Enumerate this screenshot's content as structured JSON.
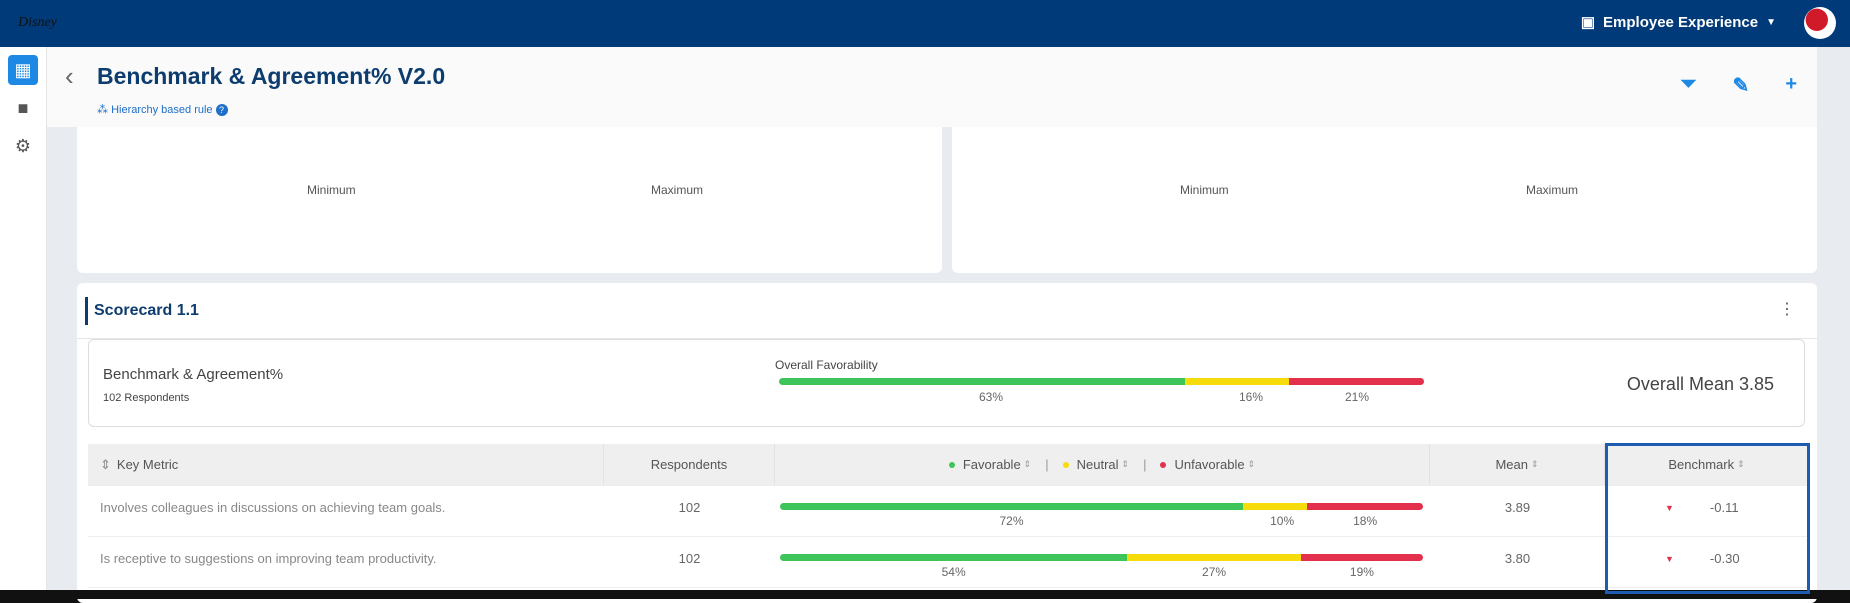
{
  "topbar": {
    "logo": "Disney",
    "app_name": "Employee Experience",
    "colors": {
      "bar": "#003a78"
    }
  },
  "header": {
    "title": "Benchmark & Agreement% V2.0",
    "rule": "Hierarchy based rule"
  },
  "cards": [
    {
      "min": "Minimum",
      "max": "Maximum"
    },
    {
      "min": "Minimum",
      "max": "Maximum"
    }
  ],
  "scorecard": {
    "title": "Scorecard 1.1",
    "summary": {
      "name": "Benchmark & Agreement%",
      "respondents": "102 Respondents",
      "fav_label": "Overall Favorability",
      "favorable": 63,
      "neutral": 16,
      "unfavorable": 21,
      "fav_text": "63%",
      "neu_text": "16%",
      "unf_text": "21%",
      "overall_mean": "Overall Mean 3.85"
    },
    "columns": {
      "key_metric": "Key Metric",
      "respondents": "Respondents",
      "favorable": "Favorable",
      "neutral": "Neutral",
      "unfavorable": "Unfavorable",
      "mean": "Mean",
      "benchmark": "Benchmark"
    },
    "rows": [
      {
        "metric": "Involves colleagues in discussions on achieving team goals.",
        "respondents": "102",
        "favorable": 72,
        "neutral": 10,
        "unfavorable": 18,
        "fav_text": "72%",
        "neu_text": "10%",
        "unf_text": "18%",
        "mean": "3.89",
        "benchmark": "-0.11"
      },
      {
        "metric": "Is receptive to suggestions on improving team productivity.",
        "respondents": "102",
        "favorable": 54,
        "neutral": 27,
        "unfavorable": 19,
        "fav_text": "54%",
        "neu_text": "27%",
        "unf_text": "19%",
        "mean": "3.80",
        "benchmark": "-0.30"
      }
    ]
  },
  "colors": {
    "favorable": "#3dc55a",
    "neutral": "#f7dc0b",
    "unfavorable": "#e2304d",
    "highlight": "#1d5cb0"
  }
}
